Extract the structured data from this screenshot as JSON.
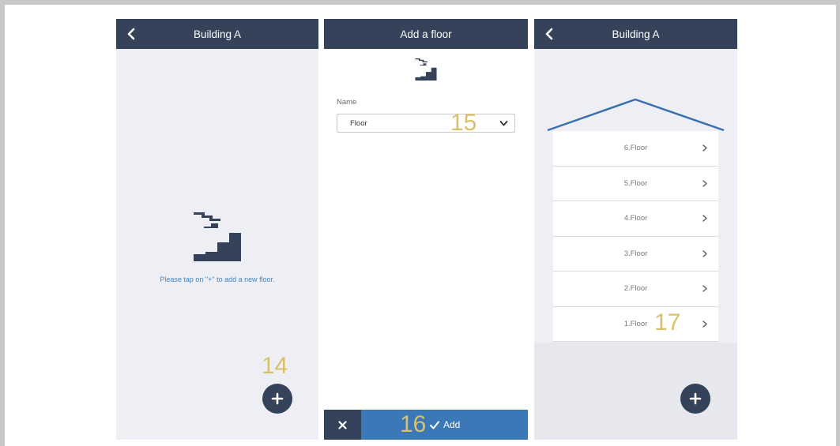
{
  "colors": {
    "header": "#34425a",
    "accent_blue": "#3a78b8",
    "callout": "#d9c06a",
    "screen_bg": "#eeeff4"
  },
  "screen1": {
    "title": "Building A",
    "back_icon": "chevron-left-icon",
    "empty_message": "Please tap on \"+\" to add a new floor.",
    "add_icon": "plus-icon",
    "callout": "14"
  },
  "screen2": {
    "title": "Add a floor",
    "name_label": "Name",
    "select_value": "Floor",
    "callout_select": "15",
    "cancel_icon": "close-icon",
    "add_label": "Add",
    "callout_add": "16"
  },
  "screen3": {
    "title": "Building A",
    "floors": [
      "6.Floor",
      "5.Floor",
      "4.Floor",
      "3.Floor",
      "2.Floor",
      "1.Floor"
    ],
    "callout": "17"
  }
}
